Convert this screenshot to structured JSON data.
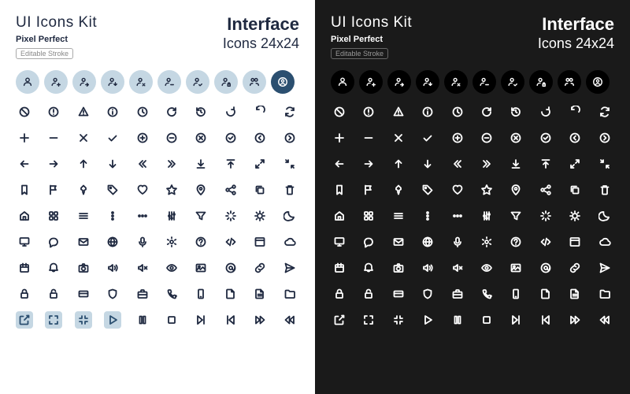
{
  "header": {
    "title": "UI Icons Kit",
    "subtitle": "Pixel Perfect",
    "tag": "Editable Stroke",
    "brand": "Interface",
    "dimensions": "Icons 24x24"
  },
  "user_icons": [
    "user",
    "user-add",
    "user-right",
    "user-down",
    "user-remove",
    "user-minus",
    "user-check",
    "user-lock",
    "user-pair",
    "user-circle"
  ],
  "grid_icons": [
    "ban",
    "alert-circle",
    "warning-triangle",
    "info",
    "clock",
    "refresh",
    "history",
    "rotate",
    "rotate-cw",
    "sync",
    "plus",
    "minus",
    "x",
    "check",
    "plus-circle",
    "minus-circle",
    "x-circle",
    "check-circle",
    "chevron-left-circle",
    "chevron-right-circle",
    "arrow-left",
    "arrow-right",
    "arrow-up",
    "arrow-down",
    "chevrons-left",
    "chevrons-right",
    "download",
    "upload",
    "expand",
    "collapse",
    "bookmark",
    "flag",
    "pin",
    "tag",
    "heart",
    "star",
    "location",
    "share",
    "copy",
    "trash",
    "home",
    "apps",
    "menu",
    "more-vertical",
    "more-horizontal",
    "sliders",
    "filter",
    "loader",
    "sun",
    "moon",
    "monitor",
    "chat",
    "mail",
    "globe",
    "mic",
    "settings",
    "help",
    "code",
    "window",
    "cloud",
    "calendar",
    "bell",
    "camera",
    "volume",
    "volume-off",
    "eye",
    "image",
    "at-sign",
    "link",
    "send",
    "lock",
    "unlock",
    "credit-card",
    "shield",
    "briefcase",
    "phone",
    "smartphone",
    "file",
    "file-text",
    "folder",
    "external",
    "maximize",
    "minimize",
    "play",
    "pause",
    "stop",
    "skip-forward",
    "skip-back",
    "fast-forward",
    "rewind"
  ],
  "highlighted": [
    80,
    81,
    82,
    83
  ]
}
